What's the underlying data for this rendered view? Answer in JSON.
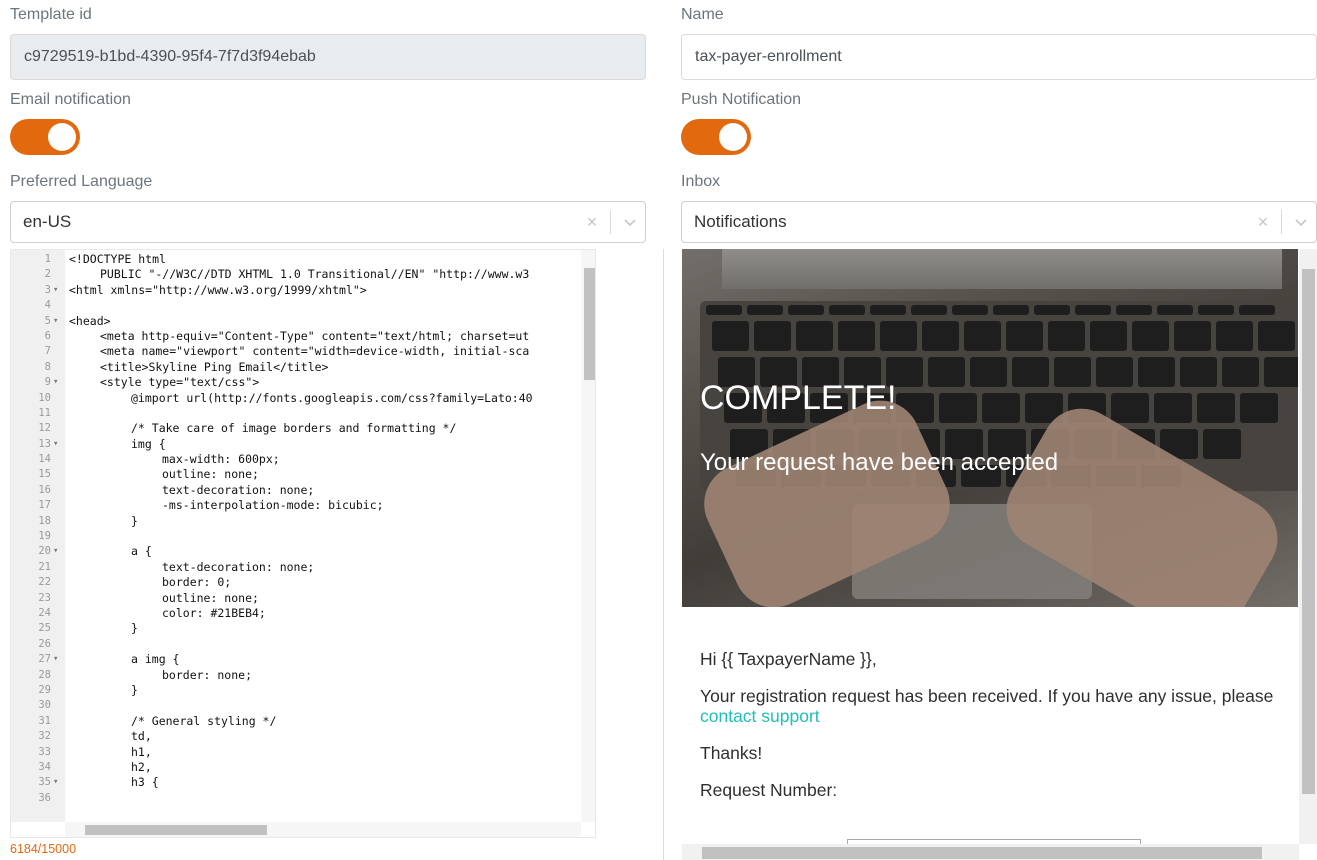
{
  "template_id": {
    "label": "Template id",
    "value": "c9729519-b1bd-4390-95f4-7f7d3f94ebab"
  },
  "name": {
    "label": "Name",
    "value": "tax-payer-enrollment"
  },
  "email_notification": {
    "label": "Email notification",
    "enabled": true
  },
  "push_notification": {
    "label": "Push Notification",
    "enabled": true
  },
  "preferred_language": {
    "label": "Preferred Language",
    "value": "en-US",
    "clear": "×"
  },
  "inbox": {
    "label": "Inbox",
    "value": "Notifications",
    "clear": "×"
  },
  "accent_color": "#e3690f",
  "editor": {
    "char_count": "6184/15000",
    "lines": [
      {
        "n": "1",
        "fold": "",
        "indent": 0,
        "text": "<!DOCTYPE html"
      },
      {
        "n": "2",
        "fold": "",
        "indent": 1,
        "text": "PUBLIC \"-//W3C//DTD XHTML 1.0 Transitional//EN\" \"http://www.w3"
      },
      {
        "n": "3",
        "fold": "▾",
        "indent": 0,
        "text": "<html xmlns=\"http://www.w3.org/1999/xhtml\">"
      },
      {
        "n": "4",
        "fold": "",
        "indent": 0,
        "text": ""
      },
      {
        "n": "5",
        "fold": "▾",
        "indent": 0,
        "text": "<head>"
      },
      {
        "n": "6",
        "fold": "",
        "indent": 1,
        "text": "<meta http-equiv=\"Content-Type\" content=\"text/html; charset=ut"
      },
      {
        "n": "7",
        "fold": "",
        "indent": 1,
        "text": "<meta name=\"viewport\" content=\"width=device-width, initial-sca"
      },
      {
        "n": "8",
        "fold": "",
        "indent": 1,
        "text": "<title>Skyline Ping Email</title>"
      },
      {
        "n": "9",
        "fold": "▾",
        "indent": 1,
        "text": "<style type=\"text/css\">"
      },
      {
        "n": "10",
        "fold": "",
        "indent": 2,
        "text": "@import url(http://fonts.googleapis.com/css?family=Lato:40"
      },
      {
        "n": "11",
        "fold": "",
        "indent": 0,
        "text": ""
      },
      {
        "n": "12",
        "fold": "",
        "indent": 2,
        "text": "/* Take care of image borders and formatting */"
      },
      {
        "n": "13",
        "fold": "▾",
        "indent": 2,
        "text": "img {"
      },
      {
        "n": "14",
        "fold": "",
        "indent": 3,
        "text": "max-width: 600px;"
      },
      {
        "n": "15",
        "fold": "",
        "indent": 3,
        "text": "outline: none;"
      },
      {
        "n": "16",
        "fold": "",
        "indent": 3,
        "text": "text-decoration: none;"
      },
      {
        "n": "17",
        "fold": "",
        "indent": 3,
        "text": "-ms-interpolation-mode: bicubic;"
      },
      {
        "n": "18",
        "fold": "",
        "indent": 2,
        "text": "}"
      },
      {
        "n": "19",
        "fold": "",
        "indent": 0,
        "text": ""
      },
      {
        "n": "20",
        "fold": "▾",
        "indent": 2,
        "text": "a {"
      },
      {
        "n": "21",
        "fold": "",
        "indent": 3,
        "text": "text-decoration: none;"
      },
      {
        "n": "22",
        "fold": "",
        "indent": 3,
        "text": "border: 0;"
      },
      {
        "n": "23",
        "fold": "",
        "indent": 3,
        "text": "outline: none;"
      },
      {
        "n": "24",
        "fold": "",
        "indent": 3,
        "text": "color: #21BEB4;"
      },
      {
        "n": "25",
        "fold": "",
        "indent": 2,
        "text": "}"
      },
      {
        "n": "26",
        "fold": "",
        "indent": 0,
        "text": ""
      },
      {
        "n": "27",
        "fold": "▾",
        "indent": 2,
        "text": "a img {"
      },
      {
        "n": "28",
        "fold": "",
        "indent": 3,
        "text": "border: none;"
      },
      {
        "n": "29",
        "fold": "",
        "indent": 2,
        "text": "}"
      },
      {
        "n": "30",
        "fold": "",
        "indent": 0,
        "text": ""
      },
      {
        "n": "31",
        "fold": "",
        "indent": 2,
        "text": "/* General styling */"
      },
      {
        "n": "32",
        "fold": "",
        "indent": 2,
        "text": "td,"
      },
      {
        "n": "33",
        "fold": "",
        "indent": 2,
        "text": "h1,"
      },
      {
        "n": "34",
        "fold": "",
        "indent": 2,
        "text": "h2,"
      },
      {
        "n": "35",
        "fold": "▾",
        "indent": 2,
        "text": "h3 {"
      },
      {
        "n": "36",
        "fold": "",
        "indent": 0,
        "text": ""
      }
    ]
  },
  "preview": {
    "hero_title": "COMPLETE!",
    "hero_subtitle": "Your request have been accepted",
    "greeting": "Hi {{ TaxpayerName }},",
    "message": "Your registration request has been received. If you have any issue, please",
    "link_text": "contact support",
    "link_color": "#21BEB4",
    "thanks": "Thanks!",
    "request_label": "Request Number:"
  }
}
